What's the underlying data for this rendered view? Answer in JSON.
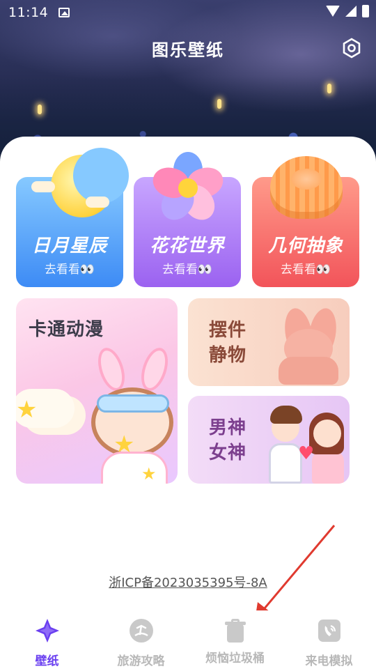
{
  "status_bar": {
    "time": "11:14"
  },
  "header": {
    "title": "图乐壁纸"
  },
  "categories": [
    {
      "label": "日月星辰",
      "sub": "去看看👀"
    },
    {
      "label": "花花世界",
      "sub": "去看看👀"
    },
    {
      "label": "几何抽象",
      "sub": "去看看👀"
    }
  ],
  "cards": {
    "cartoon": "卡通动漫",
    "ornament_line1": "摆件",
    "ornament_line2": "静物",
    "couple_line1": "男神",
    "couple_line2": "女神"
  },
  "footer": {
    "icp": "浙ICP备2023035395号-8A"
  },
  "nav": [
    {
      "label": "壁纸",
      "active": true
    },
    {
      "label": "旅游攻略",
      "active": false
    },
    {
      "label": "烦恼垃圾桶",
      "active": false
    },
    {
      "label": "来电模拟",
      "active": false
    }
  ],
  "colors": {
    "accent": "#6a3ff0",
    "annotation": "#e03a2f"
  }
}
